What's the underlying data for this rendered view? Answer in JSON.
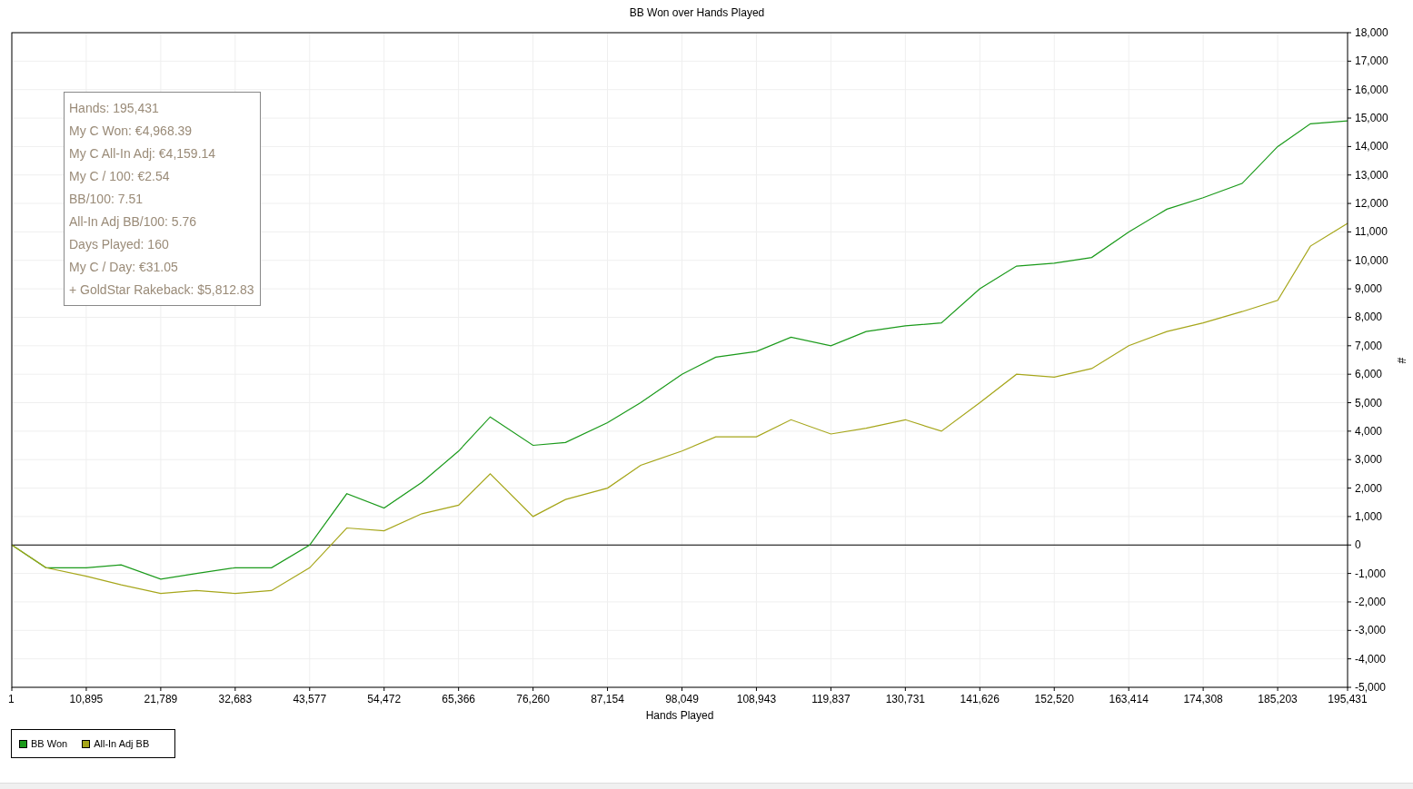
{
  "chart": {
    "chart_data": {
      "type": "line",
      "title": "BB Won over Hands Played",
      "xlabel": "Hands Played",
      "ylabel": "#",
      "x": [
        1,
        5000,
        10895,
        16000,
        21789,
        27000,
        32683,
        38000,
        43577,
        49000,
        54472,
        60000,
        65366,
        70000,
        76260,
        81000,
        87154,
        92000,
        98049,
        103000,
        108943,
        114000,
        119837,
        125000,
        130731,
        136000,
        141626,
        147000,
        152520,
        158000,
        163414,
        169000,
        174308,
        180000,
        185203,
        190000,
        195431
      ],
      "series": [
        {
          "name": "BB Won",
          "color": "#1a9a1a",
          "values": [
            0,
            -800,
            -800,
            -700,
            -1200,
            -1000,
            -800,
            -800,
            0,
            1800,
            1300,
            2200,
            3300,
            4500,
            3500,
            3600,
            4300,
            5000,
            6000,
            6600,
            6800,
            7300,
            7000,
            7500,
            7700,
            7800,
            9000,
            9800,
            9900,
            10100,
            11000,
            11800,
            12200,
            12700,
            14000,
            14800,
            14900
          ]
        },
        {
          "name": "All-In Adj BB",
          "color": "#a6a61a",
          "values": [
            0,
            -800,
            -1100,
            -1400,
            -1700,
            -1600,
            -1700,
            -1600,
            -800,
            600,
            500,
            1100,
            1400,
            2500,
            1000,
            1600,
            2000,
            2800,
            3300,
            3800,
            3800,
            4400,
            3900,
            4100,
            4400,
            4000,
            5000,
            6000,
            5900,
            6200,
            7000,
            7500,
            7800,
            8200,
            8600,
            10500,
            11300
          ]
        }
      ],
      "xlim": [
        1,
        195431
      ],
      "ylim": [
        -5000,
        18000
      ],
      "grid": true,
      "xticks": [
        1,
        {
          "value": 10895,
          "label": "10,895"
        },
        {
          "value": 21789,
          "label": "21,789"
        },
        {
          "value": 32683,
          "label": "32,683"
        },
        {
          "value": 43577,
          "label": "43,577"
        },
        {
          "value": 54472,
          "label": "54,472"
        },
        {
          "value": 65366,
          "label": "65,366"
        },
        {
          "value": 76260,
          "label": "76,260"
        },
        {
          "value": 87154,
          "label": "87,154"
        },
        {
          "value": 98049,
          "label": "98,049"
        },
        {
          "value": 108943,
          "label": "108,943"
        },
        {
          "value": 119837,
          "label": "119,837"
        },
        {
          "value": 130731,
          "label": "130,731"
        },
        {
          "value": 141626,
          "label": "141,626"
        },
        {
          "value": 152520,
          "label": "152,520"
        },
        {
          "value": 163414,
          "label": "163,414"
        },
        {
          "value": 174308,
          "label": "174,308"
        },
        {
          "value": 185203,
          "label": "185,203"
        },
        {
          "value": 195431,
          "label": "195,431"
        }
      ],
      "yticks": [
        {
          "value": -5000,
          "label": "-5,000"
        },
        {
          "value": -4000,
          "label": "-4,000"
        },
        {
          "value": -3000,
          "label": "-3,000"
        },
        {
          "value": -2000,
          "label": "-2,000"
        },
        {
          "value": -1000,
          "label": "-1,000"
        },
        0,
        {
          "value": 1000,
          "label": "1,000"
        },
        {
          "value": 2000,
          "label": "2,000"
        },
        {
          "value": 3000,
          "label": "3,000"
        },
        {
          "value": 4000,
          "label": "4,000"
        },
        {
          "value": 5000,
          "label": "5,000"
        },
        {
          "value": 6000,
          "label": "6,000"
        },
        {
          "value": 7000,
          "label": "7,000"
        },
        {
          "value": 8000,
          "label": "8,000"
        },
        {
          "value": 9000,
          "label": "9,000"
        },
        {
          "value": 10000,
          "label": "10,000"
        },
        {
          "value": 11000,
          "label": "11,000"
        },
        {
          "value": 12000,
          "label": "12,000"
        },
        {
          "value": 13000,
          "label": "13,000"
        },
        {
          "value": 14000,
          "label": "14,000"
        },
        {
          "value": 15000,
          "label": "15,000"
        },
        {
          "value": 16000,
          "label": "16,000"
        },
        {
          "value": 17000,
          "label": "17,000"
        },
        {
          "value": 18000,
          "label": "18,000"
        }
      ]
    }
  },
  "stats_box": {
    "lines": [
      "Hands: 195,431",
      "My C Won: €4,968.39",
      "My C All-In Adj: €4,159.14",
      "My C / 100: €2.54",
      "BB/100: 7.51",
      "All-In Adj BB/100: 5.76",
      "Days Played: 160",
      "My C / Day: €31.05",
      "+ GoldStar Rakeback: $5,812.83"
    ]
  }
}
